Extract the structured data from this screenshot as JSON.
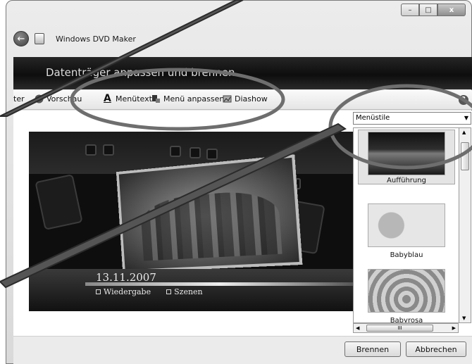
{
  "window": {
    "title": "Windows DVD Maker",
    "caption_minimize": "–",
    "caption_maximize": "□",
    "caption_close": "x"
  },
  "header": {
    "text": "Datenträger anpassen und brennen"
  },
  "toolbar": {
    "items": [
      {
        "label": "ter",
        "icon": "arrow-icon"
      },
      {
        "label": "Vorschau",
        "icon": "play-icon"
      },
      {
        "label": "Menütext",
        "icon": "text-a-icon"
      },
      {
        "label": "Menü anpassen",
        "icon": "paint-icon"
      },
      {
        "label": "Diashow",
        "icon": "slideshow-icon"
      }
    ],
    "help": "?"
  },
  "preview": {
    "date": "13.11.2007",
    "links": [
      "Wiedergabe",
      "Szenen"
    ]
  },
  "styles_panel": {
    "dropdown_value": "Menüstile",
    "items": [
      {
        "label": "Aufführung",
        "selected": true
      },
      {
        "label": "Babyblau",
        "selected": false
      },
      {
        "label": "Babyrosa",
        "selected": false
      }
    ],
    "hscroll_thumb": "III"
  },
  "footer": {
    "burn_label": "Brennen",
    "cancel_label": "Abbrechen"
  },
  "colors": {
    "header_band": "#1a1a1a",
    "annotation_stroke": "#6e6e6e"
  }
}
